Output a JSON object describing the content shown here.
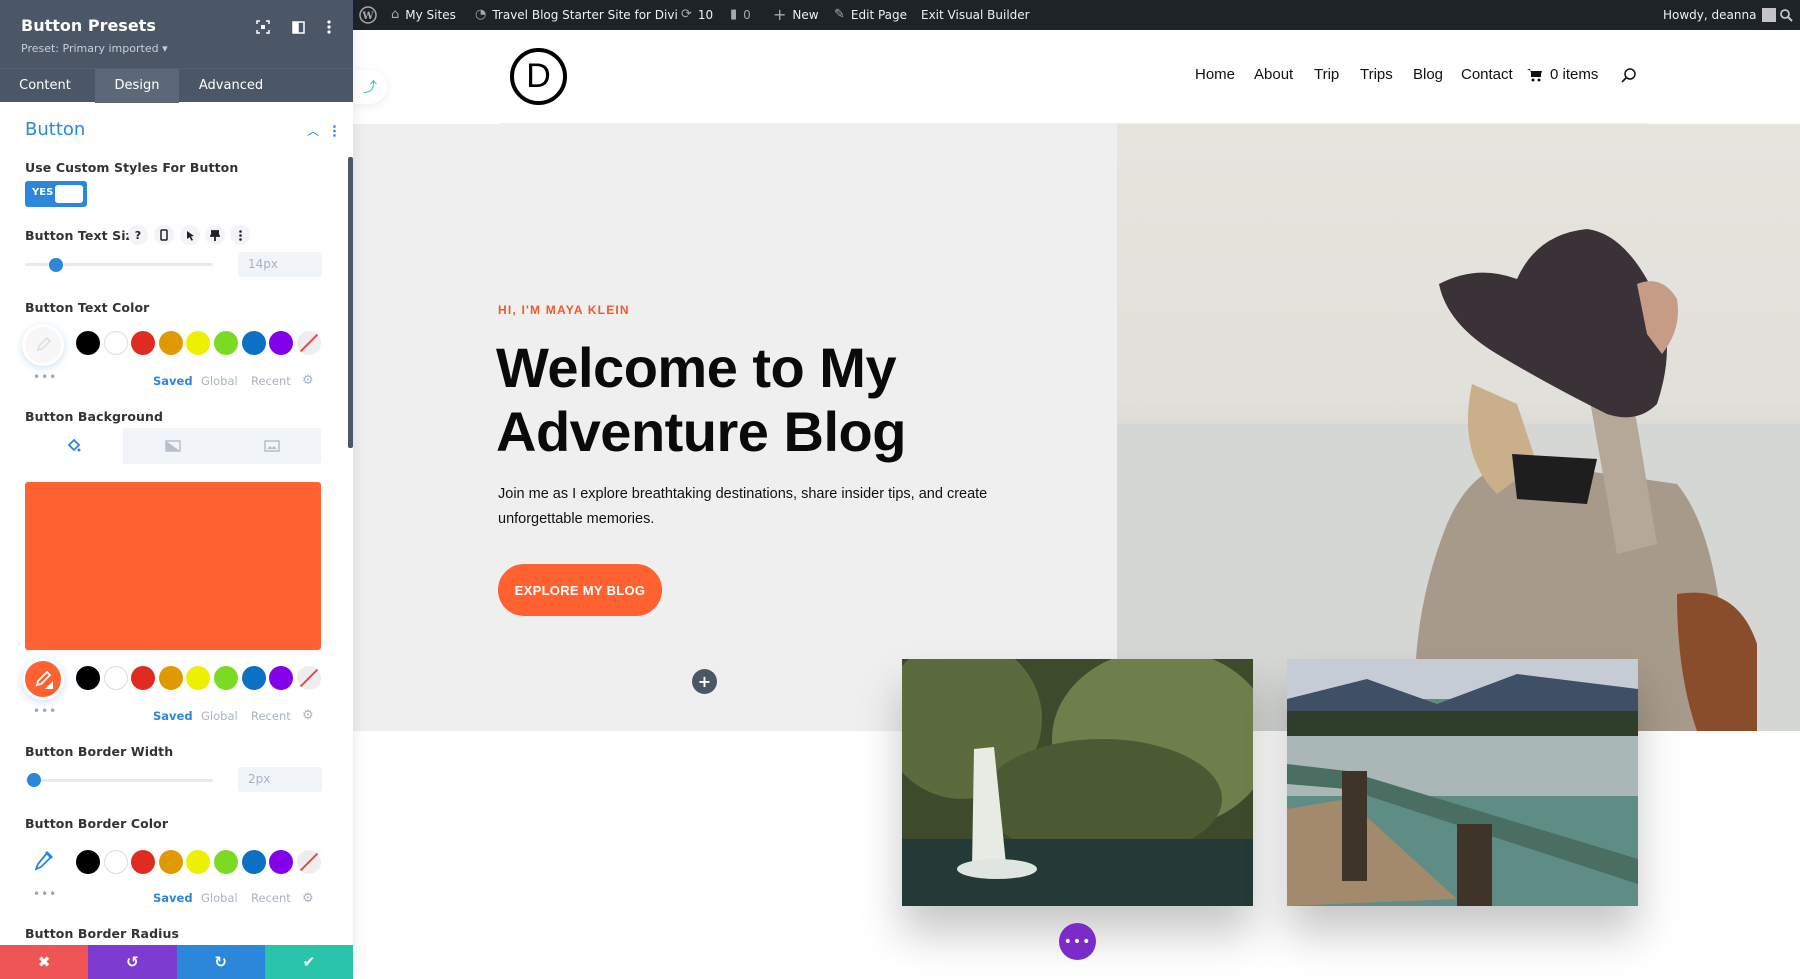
{
  "panel": {
    "title": "Button Presets",
    "preset_label": "Preset: Primary imported ▾",
    "header_icons": [
      "focus-mode-icon",
      "split-view-icon",
      "more-options-icon"
    ],
    "tabs": [
      {
        "label": "Content",
        "active": false
      },
      {
        "label": "Design",
        "active": true
      },
      {
        "label": "Advanced",
        "active": false
      }
    ],
    "section_title": "Button",
    "use_custom_styles": {
      "label": "Use Custom Styles For Button",
      "toggle_label": "YES",
      "value": true
    },
    "text_size": {
      "label": "Button Text Size",
      "value": "14px",
      "placeholder_hint": "?",
      "slider_fraction": 0.15
    },
    "text_color": {
      "label": "Button Text Color"
    },
    "background": {
      "label": "Button Background",
      "color": "#ff6131"
    },
    "border_width": {
      "label": "Button Border Width",
      "value": "2px",
      "slider_fraction": 0.03
    },
    "border_color": {
      "label": "Button Border Color"
    },
    "border_radius": {
      "label": "Button Border Radius"
    },
    "swatches": [
      "#000000",
      "#ffffff",
      "#e02b20",
      "#e09900",
      "#edf000",
      "#7cda24",
      "#0c71c3",
      "#8300e9",
      "none"
    ],
    "palette_tabs": {
      "saved": "Saved",
      "global": "Global",
      "recent": "Recent"
    },
    "more_dots": "•••",
    "footer": {
      "buttons": [
        {
          "name": "discard",
          "icon": "✖",
          "color": "#ef5555"
        },
        {
          "name": "undo",
          "icon": "↺",
          "color": "#7e3bd0"
        },
        {
          "name": "redo",
          "icon": "↻",
          "color": "#2b87da"
        },
        {
          "name": "save",
          "icon": "✔",
          "color": "#29c4a9"
        }
      ]
    }
  },
  "adminbar": {
    "my_sites": "My Sites",
    "site_name": "Travel Blog Starter Site for Divi",
    "updates_count": "10",
    "comments_count": "0",
    "new_label": "New",
    "edit_page": "Edit Page",
    "exit_vb": "Exit Visual Builder",
    "howdy": "Howdy, deanna"
  },
  "site": {
    "logo_letter": "D",
    "nav": [
      "Home",
      "About",
      "Trip",
      "Trips",
      "Blog",
      "Contact"
    ],
    "cart_label": "0 items",
    "hero": {
      "eyebrow": "HI, I'M MAYA KLEIN",
      "title": "Welcome to My Adventure Blog",
      "text": "Join me as I explore breathtaking destinations, share insider tips, and create unforgettable memories.",
      "cta": "EXPLORE MY BLOG"
    },
    "gallery": [
      {
        "alt": "Waterfall in a lush forest"
      },
      {
        "alt": "Wooden dock railing over a mountain lake"
      }
    ]
  }
}
